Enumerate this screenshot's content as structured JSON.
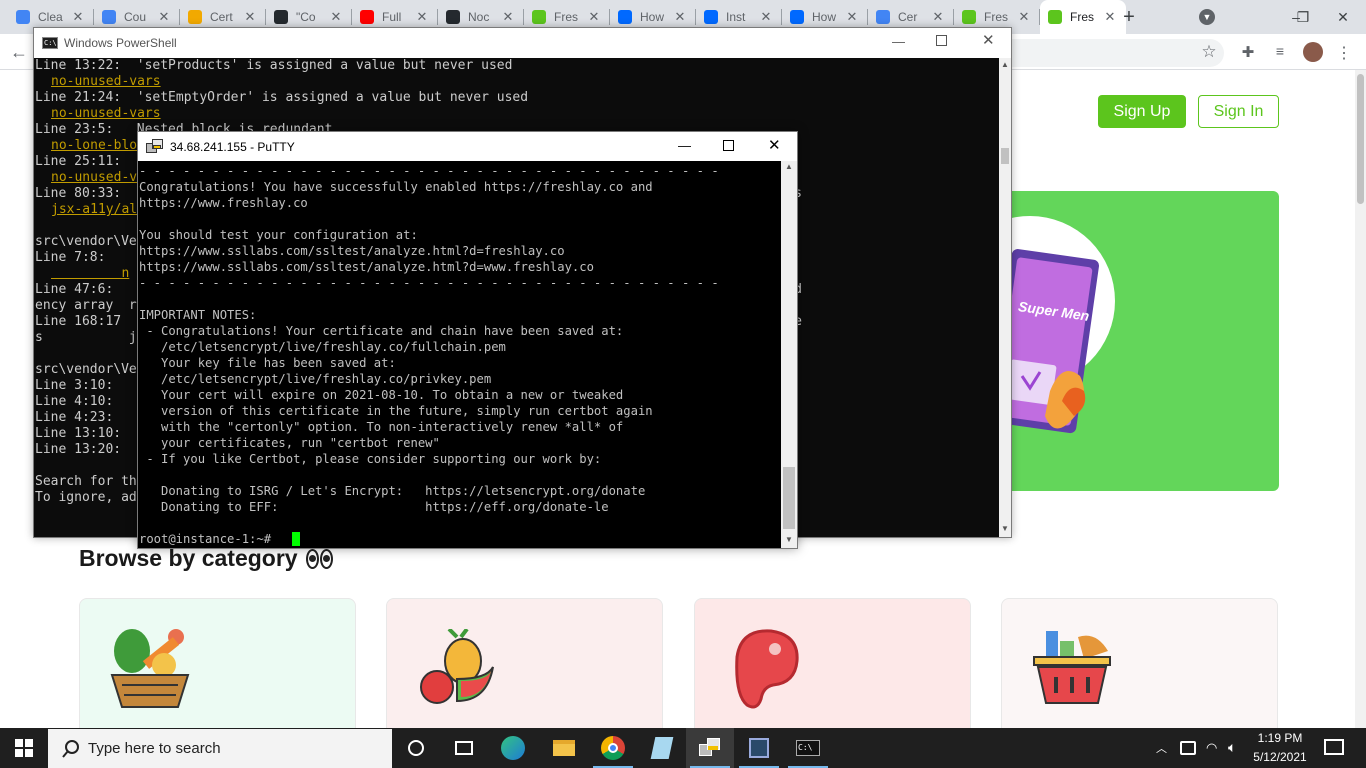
{
  "browser": {
    "tabs": [
      {
        "label": "Clea",
        "favicon": "google-icon",
        "color": "#4285f4"
      },
      {
        "label": "Cou",
        "favicon": "google-icon",
        "color": "#4285f4"
      },
      {
        "label": "Cert",
        "favicon": "letsencrypt-icon",
        "color": "#f2a900"
      },
      {
        "label": "\"Co",
        "favicon": "github-icon",
        "color": "#24292e"
      },
      {
        "label": "Full",
        "favicon": "youtube-icon",
        "color": "#ff0000"
      },
      {
        "label": "Noc",
        "favicon": "github-icon",
        "color": "#24292e"
      },
      {
        "label": "Fres",
        "favicon": "freshlay-icon",
        "color": "#5cc51d"
      },
      {
        "label": "How",
        "favicon": "digitalocean-icon",
        "color": "#0069ff"
      },
      {
        "label": "Inst",
        "favicon": "digitalocean-icon",
        "color": "#0069ff"
      },
      {
        "label": "How",
        "favicon": "digitalocean-icon",
        "color": "#0069ff"
      },
      {
        "label": "Cer",
        "favicon": "google-icon",
        "color": "#4285f4"
      },
      {
        "label": "Fres",
        "favicon": "freshlay-icon",
        "color": "#5cc51d"
      },
      {
        "label": "Fres",
        "favicon": "freshlay-icon",
        "color": "#5cc51d",
        "active": true
      }
    ]
  },
  "site": {
    "signup": "Sign Up",
    "signin": "Sign In",
    "browse_title": "Browse by category",
    "hero_brand": "Super Men",
    "accent": "#5cc51d",
    "categories": [
      {
        "icon": "vegetables-basket-icon",
        "bg": "#ecfbf3"
      },
      {
        "icon": "fruits-icon",
        "bg": "#fbeeee"
      },
      {
        "icon": "meat-icon",
        "bg": "#fde8e8"
      },
      {
        "icon": "grocery-basket-icon",
        "bg": "#fbf6f6"
      }
    ]
  },
  "powershell": {
    "title": "Windows PowerShell",
    "lines": [
      {
        "text": "Line 13:22:  'setProducts' is assigned a value but never used",
        "style": "n"
      },
      {
        "text": "no-unused-vars",
        "style": "y",
        "indent": 2
      },
      {
        "text": "Line 21:24:  'setEmptyOrder' is assigned a value but never used",
        "style": "n"
      },
      {
        "text": "no-unused-vars",
        "style": "y",
        "indent": 2
      },
      {
        "text": "Line 23:5:   Nested block is redundant",
        "style": "n"
      },
      {
        "text": "no-lone-blo",
        "style": "y",
        "indent": 2
      },
      {
        "text": "Line 25:11:",
        "style": "n"
      },
      {
        "text": "no-unused-v",
        "style": "y",
        "indent": 2
      },
      {
        "text": "Line 80:33:                                                              ing for decorative images",
        "style": "n"
      },
      {
        "text": "jsx-a11y/al",
        "style": "y",
        "indent": 2
      },
      {
        "text": "",
        "style": "n"
      },
      {
        "text": "src\\vendor\\Ve",
        "style": "n"
      },
      {
        "text": "Line 7:8:",
        "style": "n"
      },
      {
        "text": "         n",
        "style": "y",
        "indent": 2
      },
      {
        "text": "Line 47:6:                                                               e it or remove the depend",
        "style": "n"
      },
      {
        "text": "ency array  r",
        "style": "n"
      },
      {
        "text": "Line 168:17                                                              ring for decorative image",
        "style": "n"
      },
      {
        "text": "s           j",
        "style": "n"
      },
      {
        "text": "",
        "style": "n"
      },
      {
        "text": "src\\vendor\\Ve",
        "style": "n"
      },
      {
        "text": "Line 3:10:",
        "style": "n"
      },
      {
        "text": "Line 4:10:",
        "style": "n"
      },
      {
        "text": "Line 4:23:",
        "style": "n"
      },
      {
        "text": "Line 13:10:",
        "style": "n"
      },
      {
        "text": "Line 13:20:",
        "style": "n"
      },
      {
        "text": "",
        "style": "n"
      },
      {
        "text": "Search for th",
        "style": "n"
      },
      {
        "text": "To ignore, ad",
        "style": "n"
      }
    ]
  },
  "putty": {
    "title": "34.68.241.155 - PuTTY",
    "lines": [
      "- - - - - - - - - - - - - - - - - - - - - - - - - - - - - - - - - - - - - - - -",
      "Congratulations! You have successfully enabled https://freshlay.co and",
      "https://www.freshlay.co",
      "",
      "You should test your configuration at:",
      "https://www.ssllabs.com/ssltest/analyze.html?d=freshlay.co",
      "https://www.ssllabs.com/ssltest/analyze.html?d=www.freshlay.co",
      "- - - - - - - - - - - - - - - - - - - - - - - - - - - - - - - - - - - - - - - -",
      "",
      "IMPORTANT NOTES:",
      " - Congratulations! Your certificate and chain have been saved at:",
      "   /etc/letsencrypt/live/freshlay.co/fullchain.pem",
      "   Your key file has been saved at:",
      "   /etc/letsencrypt/live/freshlay.co/privkey.pem",
      "   Your cert will expire on 2021-08-10. To obtain a new or tweaked",
      "   version of this certificate in the future, simply run certbot again",
      "   with the \"certonly\" option. To non-interactively renew *all* of",
      "   your certificates, run \"certbot renew\"",
      " - If you like Certbot, please consider supporting our work by:",
      "",
      "   Donating to ISRG / Let's Encrypt:   https://letsencrypt.org/donate",
      "   Donating to EFF:                    https://eff.org/donate-le",
      "",
      "root@instance-1:~# "
    ]
  },
  "taskbar": {
    "search_placeholder": "Type here to search",
    "time": "1:19 PM",
    "date": "5/12/2021"
  }
}
